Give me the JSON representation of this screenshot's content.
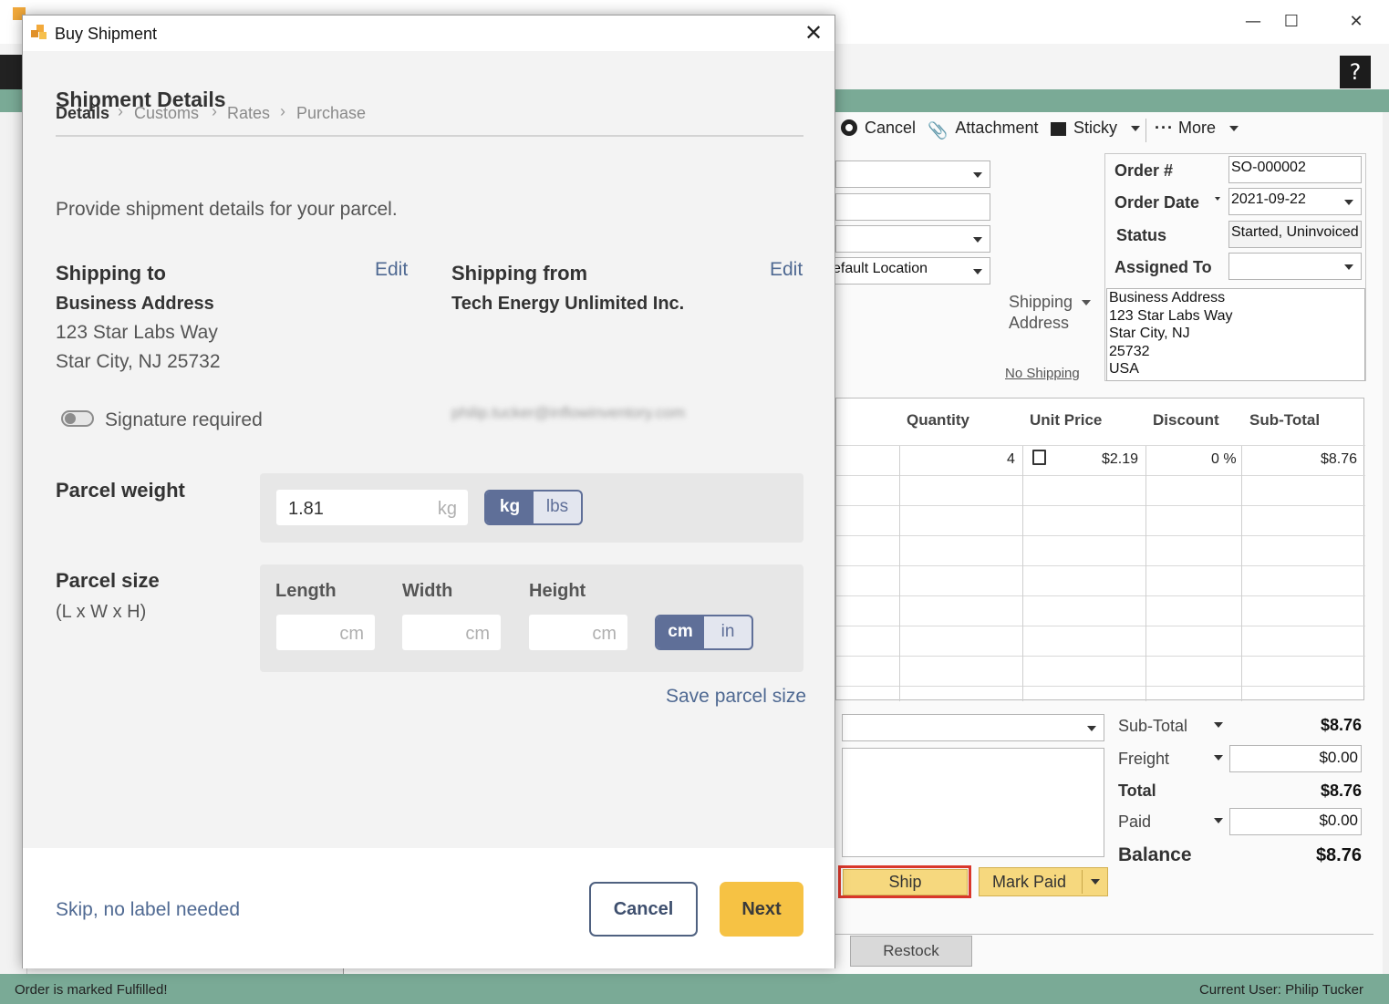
{
  "app": {
    "window_controls": {
      "minimize": "—",
      "maximize": "☐",
      "close": "✕"
    },
    "help": "?",
    "toolbar": {
      "cancel": "Cancel",
      "attachment": "Attachment",
      "sticky": "Sticky",
      "more": "More"
    },
    "location_value": "efault Location",
    "order": {
      "order_no_label": "Order #",
      "order_no": "SO-000002",
      "order_date_label": "Order Date",
      "order_date": "2021-09-22",
      "status_label": "Status",
      "status": "Started, Uninvoiced",
      "assigned_to_label": "Assigned To",
      "assigned_to": ""
    },
    "shipping_address_label": "Shipping\nAddress",
    "shipping_address_l1": "Shipping",
    "shipping_address_l2": "Address",
    "no_shipping": "No Shipping",
    "shipping_address_lines": [
      "Business Address",
      "123 Star Labs Way",
      "Star City, NJ",
      "25732",
      "USA"
    ],
    "grid": {
      "headers": [
        "Quantity",
        "Unit Price",
        "Discount",
        "Sub-Total"
      ],
      "row": {
        "quantity": "4",
        "unit_price": "$2.19",
        "discount": "0 %",
        "subtotal": "$8.76"
      }
    },
    "totals": {
      "subtotal_label": "Sub-Total",
      "subtotal": "$8.76",
      "freight_label": "Freight",
      "freight": "$0.00",
      "total_label": "Total",
      "total": "$8.76",
      "paid_label": "Paid",
      "paid": "$0.00",
      "balance_label": "Balance",
      "balance": "$8.76"
    },
    "ship_button": "Ship",
    "mark_paid_button": "Mark Paid",
    "restock_tab": "Restock",
    "status_left": "Order is marked Fulfilled!",
    "status_right": "Current User:  Philip Tucker",
    "accent_green": "#7aaa96",
    "highlight_red": "#d9372b"
  },
  "dialog": {
    "title": "Buy Shipment",
    "heading": "Shipment Details",
    "breadcrumb": [
      "Details",
      "Customs",
      "Rates",
      "Purchase"
    ],
    "intro": "Provide shipment details for your parcel.",
    "ship_to": {
      "title": "Shipping to",
      "edit": "Edit",
      "name": "Business Address",
      "line1": "123 Star Labs Way",
      "line2": "Star City, NJ 25732"
    },
    "ship_from": {
      "title": "Shipping from",
      "edit": "Edit",
      "name": "Tech Energy Unlimited Inc.",
      "email": "philip.tucker@inflowinventory.com"
    },
    "signature_label": "Signature required",
    "weight": {
      "title": "Parcel weight",
      "value": "1.81",
      "unit": "kg",
      "opt_kg": "kg",
      "opt_lbs": "lbs",
      "selected": "kg"
    },
    "size": {
      "title": "Parcel size",
      "subtitle": "(L x W x H)",
      "length_label": "Length",
      "width_label": "Width",
      "height_label": "Height",
      "unit": "cm",
      "opt_cm": "cm",
      "opt_in": "in",
      "selected": "cm"
    },
    "save_parcel_size": "Save parcel size",
    "skip": "Skip, no label needed",
    "cancel": "Cancel",
    "next": "Next",
    "primary_color": "#5f6f98",
    "next_color": "#f6c244"
  }
}
